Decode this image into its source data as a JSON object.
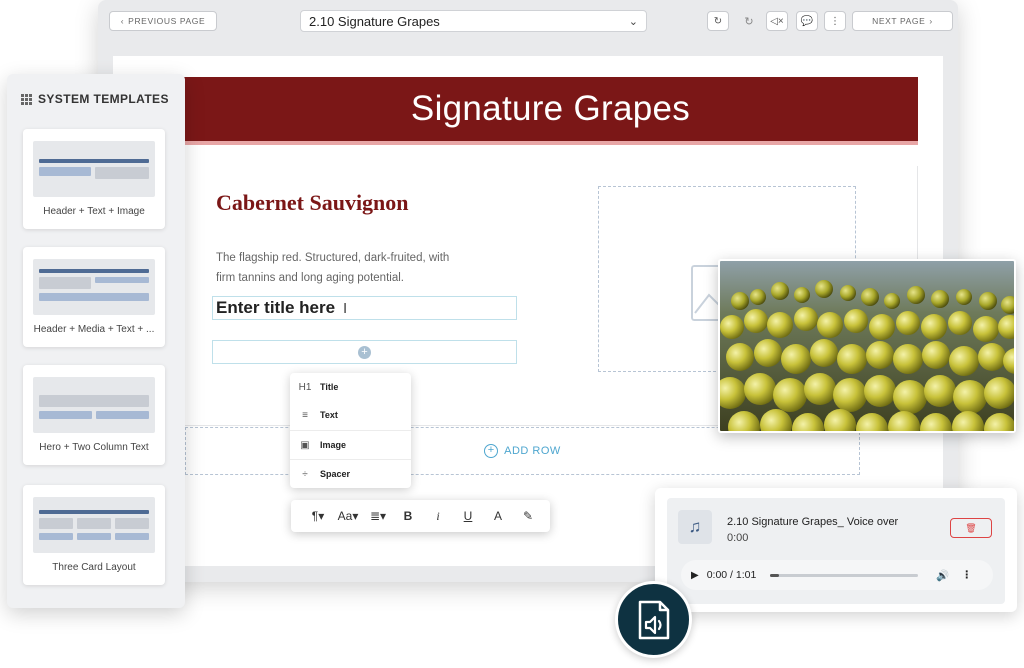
{
  "topbar": {
    "prev_label": "PREVIOUS PAGE",
    "next_label": "NEXT PAGE",
    "page_select_value": "2.10  Signature Grapes"
  },
  "icons": {
    "prev": "chevron-left-icon",
    "next": "chevron-right-icon",
    "dropdown": "chevron-down-icon",
    "reset": "refresh-icon",
    "redo": "redo-icon",
    "mute": "speaker-mute-icon",
    "comment": "speech-bubble-icon",
    "more": "vertical-dots-icon"
  },
  "banner": {
    "title": "Signature Grapes"
  },
  "content": {
    "heading": "Cabernet Sauvignon",
    "description": "The flagship red. Structured, dark-fruited, with firm tannins and long aging potential.",
    "title_placeholder": "Enter title here",
    "add_row_label": "ADD ROW"
  },
  "block_menu": {
    "items": [
      {
        "icon": "H1",
        "label": "Title"
      },
      {
        "icon": "≡",
        "label": "Text"
      },
      {
        "icon": "▣",
        "label": "Image"
      },
      {
        "icon": "÷",
        "label": "Spacer"
      }
    ]
  },
  "format_toolbar": {
    "buttons": [
      "¶▾",
      "Aa▾",
      "≣▾",
      "B",
      "i",
      "U",
      "A",
      "✎"
    ]
  },
  "sidebar": {
    "title": "SYSTEM TEMPLATES",
    "templates": [
      {
        "label": "Header + Text + Image"
      },
      {
        "label": "Header + Media + Text + ..."
      },
      {
        "label": "Hero + Two Column Text"
      },
      {
        "label": "Three Card Layout"
      }
    ]
  },
  "audio": {
    "title": "2.10 Signature Grapes_ Voice over",
    "duration": "0:00",
    "player_time": "0:00 / 1:01",
    "progress": 0.06
  },
  "colors": {
    "banner": "#7b1717",
    "accent": "#4ea6cf",
    "badge": "#0e3241",
    "delete": "#dd4444"
  }
}
